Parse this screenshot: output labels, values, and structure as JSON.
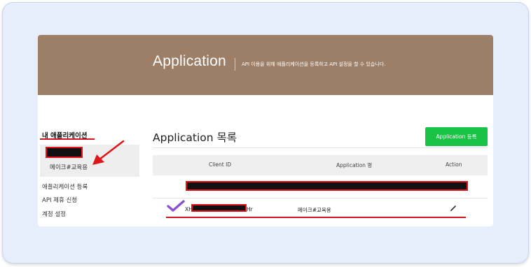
{
  "banner": {
    "title": "Application",
    "description": "API 이용을 위해 애플리케이션을 등록하고 API 설정을 할 수 있습니다."
  },
  "sidebar": {
    "section_title": "내 애플리케이션",
    "app_item_label": "메이크#교육용",
    "links": [
      "애플리케이션 등록",
      "API 제휴 신청",
      "계정 설정"
    ]
  },
  "content": {
    "title": "Application 목록",
    "register_button": "Application 등록",
    "table": {
      "headers": [
        "Client ID",
        "Application 명",
        "Action"
      ],
      "rows": [
        {
          "client_id_prefix": "XH",
          "client_id_suffix": "Hr",
          "app_name": "메이크#교육용"
        }
      ]
    }
  },
  "colors": {
    "banner_bg": "#9c7f66",
    "button_bg": "#19c244",
    "annotation_red": "#d0161b",
    "check_purple": "#8a4fd3"
  },
  "icons": [
    "check-icon",
    "pencil-icon",
    "red-arrow-annotation"
  ]
}
